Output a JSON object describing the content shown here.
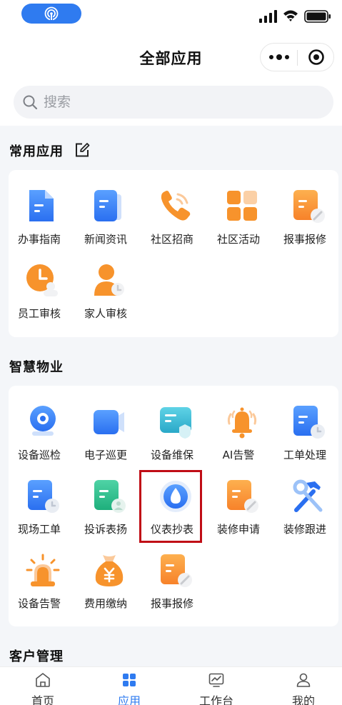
{
  "header": {
    "title": "全部应用"
  },
  "search": {
    "placeholder": "搜索"
  },
  "sections": {
    "common": {
      "title": "常用应用",
      "apps": [
        {
          "label": "办事指南",
          "icon": "document-icon"
        },
        {
          "label": "新闻资讯",
          "icon": "news-icon"
        },
        {
          "label": "社区招商",
          "icon": "phone-icon"
        },
        {
          "label": "社区活动",
          "icon": "grid-icon"
        },
        {
          "label": "报事报修",
          "icon": "repair-report-icon"
        },
        {
          "label": "员工审核",
          "icon": "staff-review-icon"
        },
        {
          "label": "家人审核",
          "icon": "family-review-icon"
        }
      ]
    },
    "property": {
      "title": "智慧物业",
      "apps": [
        {
          "label": "设备巡检",
          "icon": "device-inspection-icon"
        },
        {
          "label": "电子巡更",
          "icon": "video-patrol-icon"
        },
        {
          "label": "设备维保",
          "icon": "device-maintenance-icon"
        },
        {
          "label": "AI告警",
          "icon": "bell-icon"
        },
        {
          "label": "工单处理",
          "icon": "work-order-icon"
        },
        {
          "label": "现场工单",
          "icon": "onsite-order-icon"
        },
        {
          "label": "投诉表扬",
          "icon": "complaint-icon"
        },
        {
          "label": "仪表抄表",
          "icon": "water-drop-icon"
        },
        {
          "label": "装修申请",
          "icon": "renovation-apply-icon"
        },
        {
          "label": "装修跟进",
          "icon": "hammer-wrench-icon"
        },
        {
          "label": "设备告警",
          "icon": "alarm-light-icon"
        },
        {
          "label": "费用缴纳",
          "icon": "money-bag-icon"
        },
        {
          "label": "报事报修",
          "icon": "repair-report-icon"
        }
      ]
    },
    "customer": {
      "title": "客户管理"
    }
  },
  "tabbar": {
    "tabs": [
      {
        "label": "首页",
        "icon": "home-icon"
      },
      {
        "label": "应用",
        "icon": "apps-icon",
        "active": true
      },
      {
        "label": "工作台",
        "icon": "workbench-icon"
      },
      {
        "label": "我的",
        "icon": "profile-icon"
      }
    ]
  },
  "colors": {
    "accent": "#2f7bf0",
    "orange": "#f7932c",
    "highlight": "#c00d16"
  }
}
